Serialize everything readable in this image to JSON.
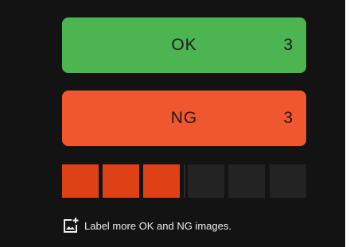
{
  "ok_card": {
    "label": "OK",
    "count": "3",
    "color": "#4cb551"
  },
  "ng_card": {
    "label": "NG",
    "count": "3",
    "color": "#f0572f"
  },
  "progress": {
    "filled_segments": 3,
    "total_segments": 6,
    "fill_color": "#de4115",
    "empty_color": "#232323"
  },
  "hint": {
    "icon": "add-image-icon",
    "text": "Label more OK and NG images."
  }
}
